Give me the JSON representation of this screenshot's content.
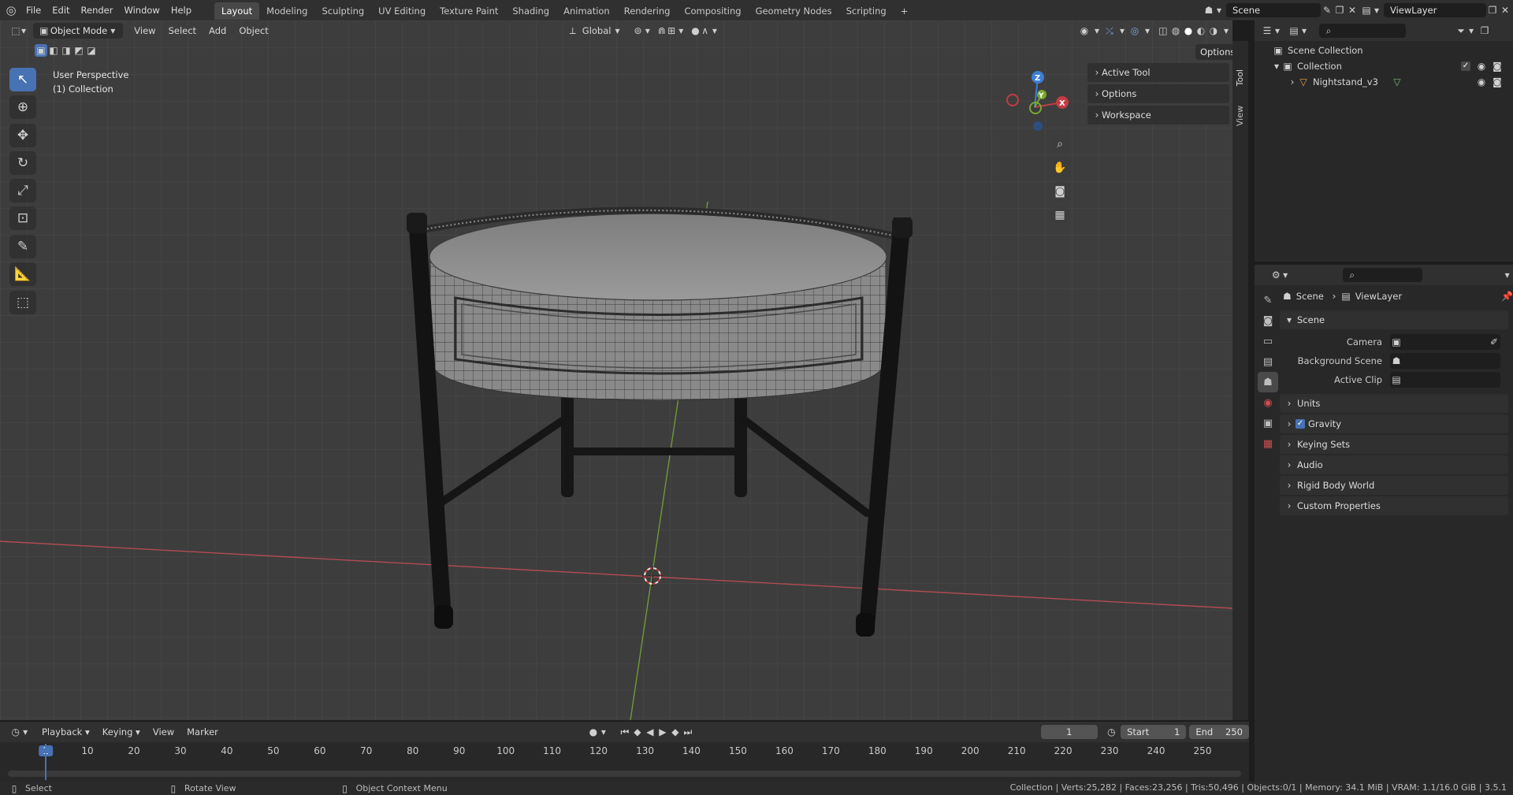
{
  "topbar": {
    "menus": [
      "File",
      "Edit",
      "Render",
      "Window",
      "Help"
    ],
    "workspaces": [
      "Layout",
      "Modeling",
      "Sculpting",
      "UV Editing",
      "Texture Paint",
      "Shading",
      "Animation",
      "Rendering",
      "Compositing",
      "Geometry Nodes",
      "Scripting"
    ],
    "active_workspace": "Layout",
    "add_workspace": "+",
    "scene_name": "Scene",
    "view_layer": "ViewLayer"
  },
  "viewport_header": {
    "mode": "Object Mode",
    "menus": [
      "View",
      "Select",
      "Add",
      "Object"
    ],
    "transform_orientation": "Global",
    "options_label": "Options"
  },
  "viewport": {
    "view_name": "User Perspective",
    "collection_name": "(1) Collection",
    "gizmo_axes": {
      "z": "Z",
      "y": "Y",
      "x": "X"
    }
  },
  "npanel": {
    "rows": [
      "Active Tool",
      "Options",
      "Workspace"
    ],
    "side_tabs": [
      "Tool",
      "View"
    ]
  },
  "outliner": {
    "root": "Scene Collection",
    "collection": "Collection",
    "object": "Nightstand_v3"
  },
  "properties": {
    "breadcrumb_scene": "Scene",
    "breadcrumb_viewlayer": "ViewLayer",
    "section_scene": "Scene",
    "fields": [
      {
        "label": "Camera"
      },
      {
        "label": "Background Scene"
      },
      {
        "label": "Active Clip"
      }
    ],
    "collapsed_sections": [
      "Units",
      "Gravity",
      "Keying Sets",
      "Audio",
      "Rigid Body World",
      "Custom Properties"
    ],
    "gravity_checked": true
  },
  "timeline": {
    "menus": [
      "Playback",
      "Keying",
      "View",
      "Marker"
    ],
    "current_frame": "1",
    "start_label": "Start",
    "start_value": "1",
    "end_label": "End",
    "end_value": "250",
    "frame_ticks": [
      "1",
      "10",
      "20",
      "30",
      "40",
      "50",
      "60",
      "70",
      "80",
      "90",
      "100",
      "110",
      "120",
      "130",
      "140",
      "150",
      "160",
      "170",
      "180",
      "190",
      "200",
      "210",
      "220",
      "230",
      "240",
      "250"
    ]
  },
  "statusbar": {
    "left": "Select",
    "middle": "Rotate View",
    "right": "Object Context Menu",
    "stats": "Collection | Verts:25,282 | Faces:23,256 | Tris:50,496 | Objects:0/1 | Memory: 34.1 MiB | VRAM: 1.1/16.0 GiB | 3.5.1"
  },
  "colors": {
    "accent": "#4772b3",
    "x_axis": "#c33c45",
    "y_axis": "#7aa830",
    "z_axis": "#3b7fd4"
  }
}
